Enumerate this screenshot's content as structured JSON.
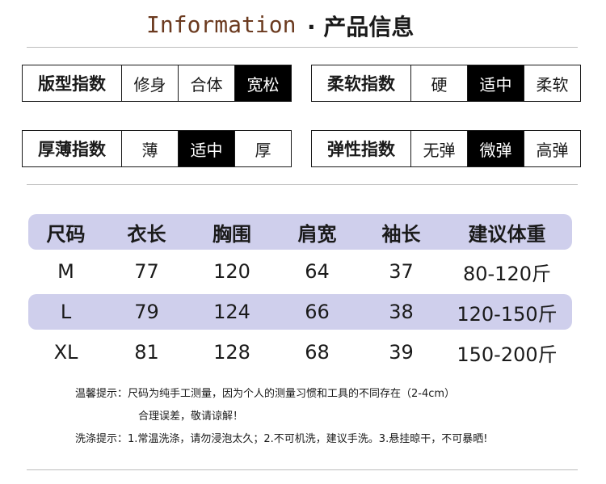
{
  "header": {
    "title_en": "Information",
    "title_zh": "· 产品信息"
  },
  "indexes": [
    {
      "label": "版型指数",
      "options": [
        "修身",
        "合体",
        "宽松"
      ],
      "active": 2
    },
    {
      "label": "柔软指数",
      "options": [
        "硬",
        "适中",
        "柔软"
      ],
      "active": 1
    },
    {
      "label": "厚薄指数",
      "options": [
        "薄",
        "适中",
        "厚"
      ],
      "active": 1
    },
    {
      "label": "弹性指数",
      "options": [
        "无弹",
        "微弹",
        "高弹"
      ],
      "active": 1
    }
  ],
  "size_table": {
    "headers": [
      "尺码",
      "衣长",
      "胸围",
      "肩宽",
      "袖长",
      "建议体重"
    ],
    "rows": [
      [
        "M",
        "77",
        "120",
        "64",
        "37",
        "80-120斤"
      ],
      [
        "L",
        "79",
        "124",
        "66",
        "38",
        "120-150斤"
      ],
      [
        "XL",
        "81",
        "128",
        "68",
        "39",
        "150-200斤"
      ]
    ]
  },
  "notes": {
    "tip_line1": "温馨提示：尺码为纯手工测量，因为个人的测量习惯和工具的不同存在（2-4cm）",
    "tip_line2": "合理误差，敬请谅解！",
    "wash": "洗涤提示：1.常温洗涤，请勿浸泡太久；2.不可机洗，建议手洗。3.悬挂晾干，不可暴晒!"
  },
  "colors": {
    "title_en": "#6b3a1f",
    "table_band": "#cfcfec",
    "active_bg": "#000000"
  }
}
